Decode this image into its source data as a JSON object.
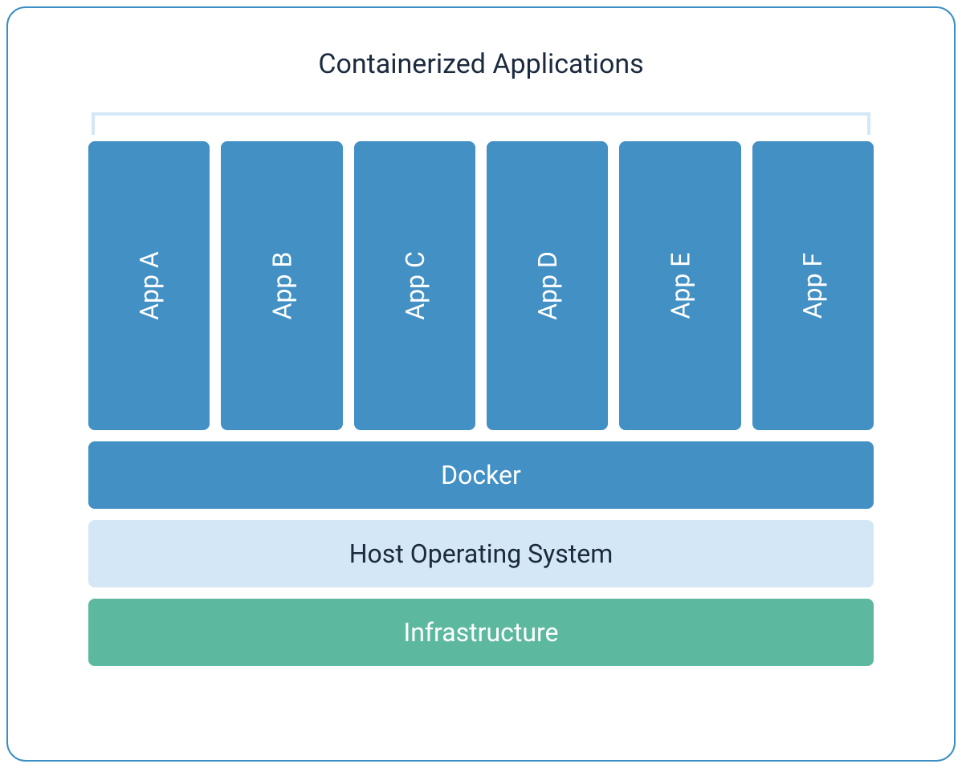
{
  "title": "Containerized Applications",
  "apps": [
    {
      "label": "App A"
    },
    {
      "label": "App B"
    },
    {
      "label": "App C"
    },
    {
      "label": "App D"
    },
    {
      "label": "App E"
    },
    {
      "label": "App F"
    }
  ],
  "layers": {
    "docker": "Docker",
    "host": "Host Operating System",
    "infrastructure": "Infrastructure"
  },
  "colors": {
    "border": "#3b8fc4",
    "app_bg": "#4290c4",
    "docker_bg": "#4290c4",
    "host_bg": "#d3e7f6",
    "infra_bg": "#5cb9a0",
    "bracket": "#d3e7f6",
    "title_text": "#1b2a3e"
  }
}
